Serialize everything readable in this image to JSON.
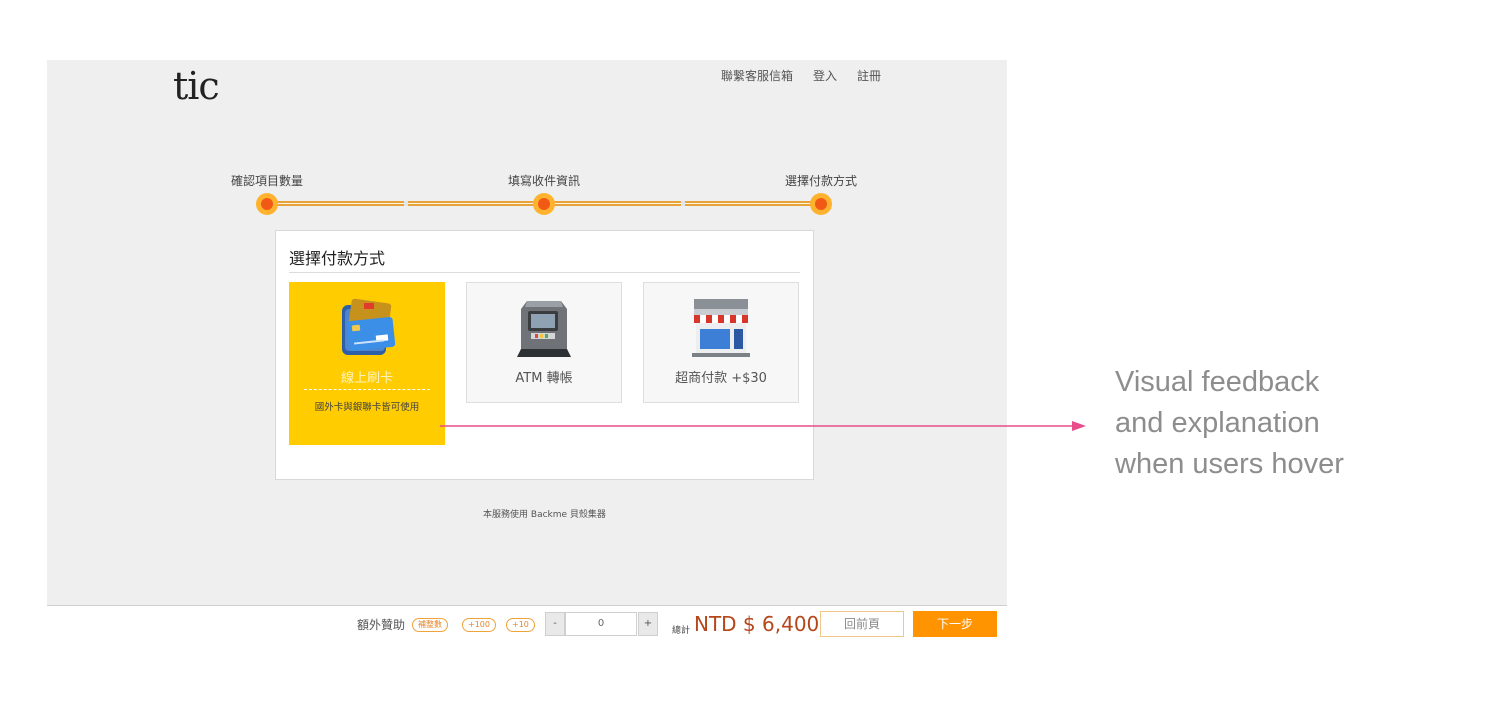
{
  "app": {
    "logo": "tic",
    "nav": [
      "聯繫客服信箱",
      "登入",
      "註冊"
    ]
  },
  "steps": [
    {
      "label": "確認項目數量"
    },
    {
      "label": "填寫收件資訊"
    },
    {
      "label": "選擇付款方式"
    }
  ],
  "panel": {
    "title": "選擇付款方式",
    "options": [
      {
        "label": "線上刷卡",
        "note": "國外卡與銀聯卡皆可使用",
        "icon": "credit-card-wallet-icon",
        "selected": true
      },
      {
        "label": "ATM 轉帳",
        "icon": "atm-machine-icon",
        "selected": false
      },
      {
        "label": "超商付款 +$30",
        "icon": "convenience-store-icon",
        "selected": false
      }
    ]
  },
  "footnote": "本服務使用 Backme 貝殼集器",
  "bottombar": {
    "extra_label": "額外贊助",
    "pills": [
      "補整數",
      "+100",
      "+10"
    ],
    "minus": "-",
    "quantity": "0",
    "plus": "+",
    "total_label": "總計",
    "total_value": "NTD $ 6,400",
    "back_label": "回前頁",
    "next_label": "下一步"
  },
  "annotation": {
    "lines": [
      "Visual feedback",
      "and explanation",
      "when users hover"
    ],
    "arrow_color": "#e84c8b"
  },
  "colors": {
    "accent_orange": "#ff9300",
    "selected_yellow": "#ffcc00",
    "price_red": "#b5461a"
  }
}
